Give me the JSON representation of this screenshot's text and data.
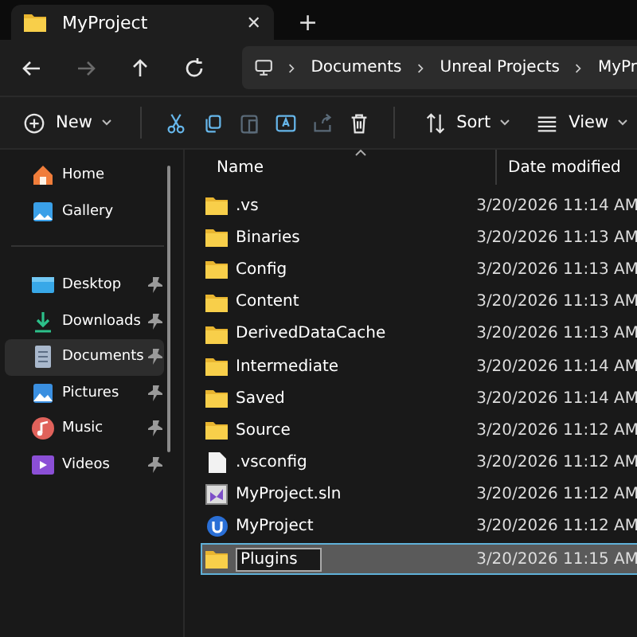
{
  "window": {
    "tab_title": "MyProject",
    "close_tab": "✕",
    "new_tab": "+"
  },
  "nav": {
    "buttons": [
      {
        "kind": "back",
        "disabled": false
      },
      {
        "kind": "forward",
        "disabled": true
      },
      {
        "kind": "up",
        "disabled": false
      },
      {
        "kind": "refresh",
        "disabled": false
      }
    ],
    "breadcrumbs": [
      "Documents",
      "Unreal Projects",
      "MyPr"
    ]
  },
  "commands": [
    {
      "kind": "new",
      "label": "New",
      "disabled": false
    },
    {
      "kind": "cut",
      "disabled": false
    },
    {
      "kind": "copy",
      "disabled": false
    },
    {
      "kind": "paste",
      "disabled": true
    },
    {
      "kind": "rename",
      "disabled": false
    },
    {
      "kind": "share",
      "disabled": true
    },
    {
      "kind": "delete",
      "disabled": false
    },
    {
      "kind": "sort",
      "label": "Sort",
      "disabled": false
    },
    {
      "kind": "view",
      "label": "View",
      "disabled": false
    }
  ],
  "sidebar": {
    "groups": [
      [
        {
          "kind": "home",
          "label": "Home",
          "pinned": false,
          "selected": false
        },
        {
          "kind": "gallery",
          "label": "Gallery",
          "pinned": false,
          "selected": false
        }
      ],
      [
        {
          "kind": "desktop",
          "label": "Desktop",
          "pinned": true,
          "selected": false
        },
        {
          "kind": "downloads",
          "label": "Downloads",
          "pinned": true,
          "selected": false
        },
        {
          "kind": "documents",
          "label": "Documents",
          "pinned": true,
          "selected": true
        },
        {
          "kind": "pictures",
          "label": "Pictures",
          "pinned": true,
          "selected": false
        },
        {
          "kind": "music",
          "label": "Music",
          "pinned": true,
          "selected": false
        },
        {
          "kind": "videos",
          "label": "Videos",
          "pinned": true,
          "selected": false
        }
      ]
    ]
  },
  "table": {
    "columns": [
      "Name",
      "Date modified"
    ],
    "rows": [
      {
        "kind": "folder",
        "name": ".vs",
        "date": "3/20/2026 11:14 AM",
        "selected": false,
        "renaming": false
      },
      {
        "kind": "folder",
        "name": "Binaries",
        "date": "3/20/2026 11:13 AM",
        "selected": false,
        "renaming": false
      },
      {
        "kind": "folder",
        "name": "Config",
        "date": "3/20/2026 11:13 AM",
        "selected": false,
        "renaming": false
      },
      {
        "kind": "folder",
        "name": "Content",
        "date": "3/20/2026 11:13 AM",
        "selected": false,
        "renaming": false
      },
      {
        "kind": "folder",
        "name": "DerivedDataCache",
        "date": "3/20/2026 11:13 AM",
        "selected": false,
        "renaming": false
      },
      {
        "kind": "folder",
        "name": "Intermediate",
        "date": "3/20/2026 11:14 AM",
        "selected": false,
        "renaming": false
      },
      {
        "kind": "folder",
        "name": "Saved",
        "date": "3/20/2026 11:14 AM",
        "selected": false,
        "renaming": false
      },
      {
        "kind": "folder",
        "name": "Source",
        "date": "3/20/2026 11:12 AM",
        "selected": false,
        "renaming": false
      },
      {
        "kind": "file",
        "name": ".vsconfig",
        "date": "3/20/2026 11:12 AM",
        "selected": false,
        "renaming": false
      },
      {
        "kind": "solution",
        "name": "MyProject.sln",
        "date": "3/20/2026 11:12 AM",
        "selected": false,
        "renaming": false
      },
      {
        "kind": "project",
        "name": "MyProject",
        "date": "3/20/2026 11:12 AM",
        "selected": false,
        "renaming": false
      },
      {
        "kind": "folder",
        "name": "Plugins",
        "date": "3/20/2026 11:15 AM",
        "selected": true,
        "renaming": true
      }
    ]
  }
}
